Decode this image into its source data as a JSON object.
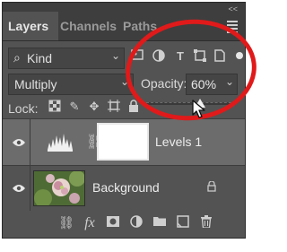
{
  "tabs": [
    {
      "label": "Layers"
    },
    {
      "label": "Channels"
    },
    {
      "label": "Paths"
    }
  ],
  "header": {
    "collapse_glyph": "<<"
  },
  "filter": {
    "kind_label": "Kind",
    "icons": [
      "image-filter-icon",
      "adjustment-filter-icon",
      "type-filter-icon",
      "shape-filter-icon",
      "smart-object-filter-icon"
    ]
  },
  "blend": {
    "mode": "Multiply"
  },
  "opacity": {
    "label": "Opacity:",
    "value": "60%",
    "fraction": 0.6
  },
  "lock": {
    "label": "Lock:",
    "icons": [
      "lock-transparent-pixels-icon",
      "lock-image-pixels-icon",
      "lock-position-icon",
      "lock-artboard-icon",
      "lock-all-icon"
    ]
  },
  "layers": [
    {
      "name": "Levels 1",
      "type": "adjustment",
      "selected": true
    },
    {
      "name": "Background",
      "type": "image",
      "locked": true
    }
  ],
  "bottom_tools": [
    "link-layers-icon",
    "fx-icon",
    "add-mask-icon",
    "adjustment-layer-icon",
    "group-folder-icon",
    "new-layer-icon",
    "delete-trash-icon"
  ],
  "colors": {
    "panel": "#535353",
    "tabbar": "#3e3e3e",
    "selected_row": "#6c6c6c",
    "annotation": "#e01a1a"
  }
}
